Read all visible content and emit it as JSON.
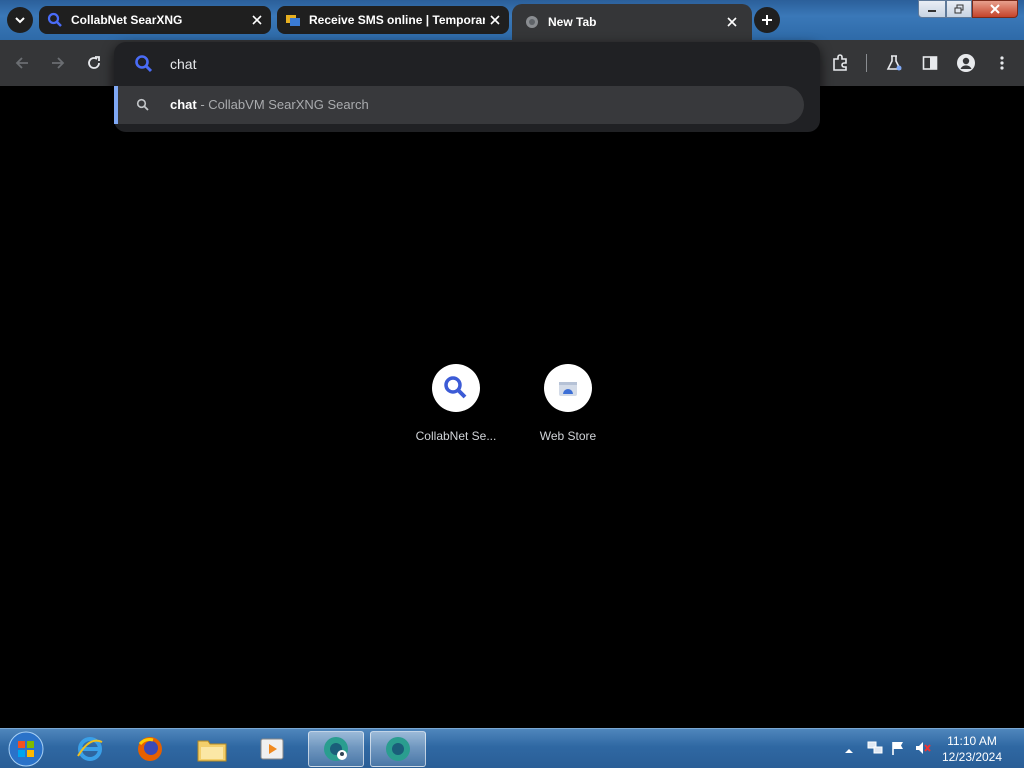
{
  "browser": {
    "tabs": [
      {
        "title": "CollabNet SearXNG",
        "close_icon": "close-icon"
      },
      {
        "title": "Receive SMS online | Temporary",
        "close_icon": "close-icon"
      }
    ],
    "active_tab": {
      "title": "New Tab"
    }
  },
  "omnibox": {
    "value": "chat",
    "suggestion": {
      "query": "chat",
      "description": " - CollabVM SearXNG Search"
    }
  },
  "shortcuts": [
    {
      "label": "CollabNet Se...",
      "icon": "search-icon"
    },
    {
      "label": "Web Store",
      "icon": "web-store-icon"
    }
  ],
  "taskbar": {
    "clock_time": "11:10 AM",
    "clock_date": "12/23/2024"
  },
  "colors": {
    "accent": "#7fa8f5",
    "search_icon_blue": "#3c5bd6",
    "tab_bg": "#1f1f1f",
    "toolbar_bg": "#353638"
  }
}
